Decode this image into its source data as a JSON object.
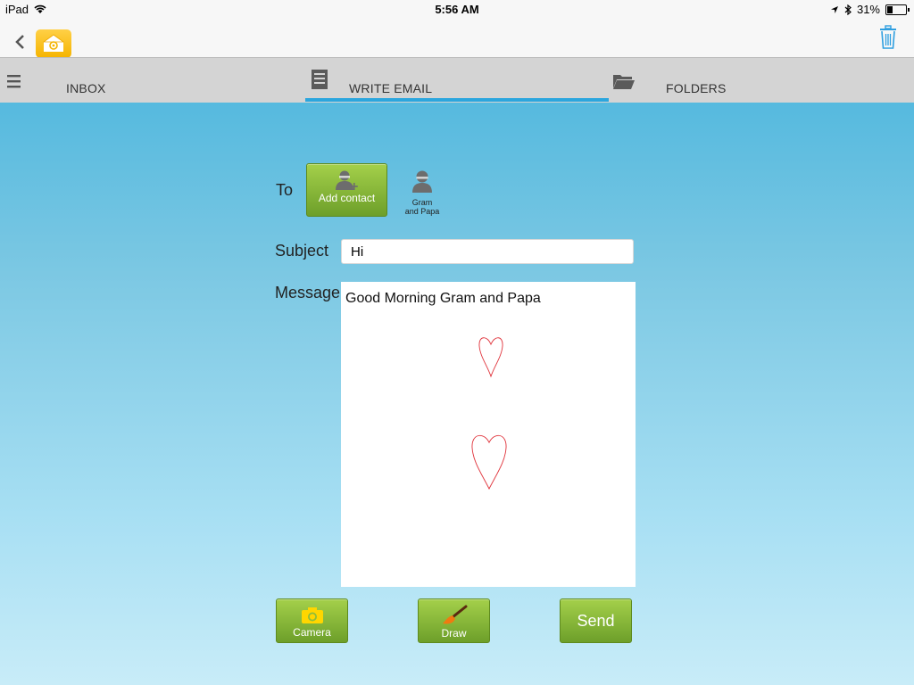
{
  "status_bar": {
    "device": "iPad",
    "time": "5:56 AM",
    "battery_percent": "31%",
    "battery_level": 0.31
  },
  "nav": {
    "back_icon": "chevron-left-icon",
    "app_icon": "email-house-icon",
    "trash_icon": "trash-icon"
  },
  "tabs": [
    {
      "label": "INBOX",
      "icon": "hamburger-icon",
      "active": false
    },
    {
      "label": "WRITE EMAIL",
      "icon": "document-icon",
      "active": true
    },
    {
      "label": "FOLDERS",
      "icon": "folder-icon",
      "active": false
    }
  ],
  "form": {
    "to_label": "To",
    "add_contact_label": "Add contact",
    "contact_line1": "Gram",
    "contact_line2": "and Papa",
    "subject_label": "Subject",
    "subject_value": "Hi",
    "message_label": "Message",
    "message_text": "Good Morning Gram and Papa"
  },
  "actions": {
    "camera_label": "Camera",
    "draw_label": "Draw",
    "send_label": "Send"
  },
  "colors": {
    "accent": "#2ba6de",
    "button_green": "#7fb236",
    "drawing": "#e0323a"
  }
}
